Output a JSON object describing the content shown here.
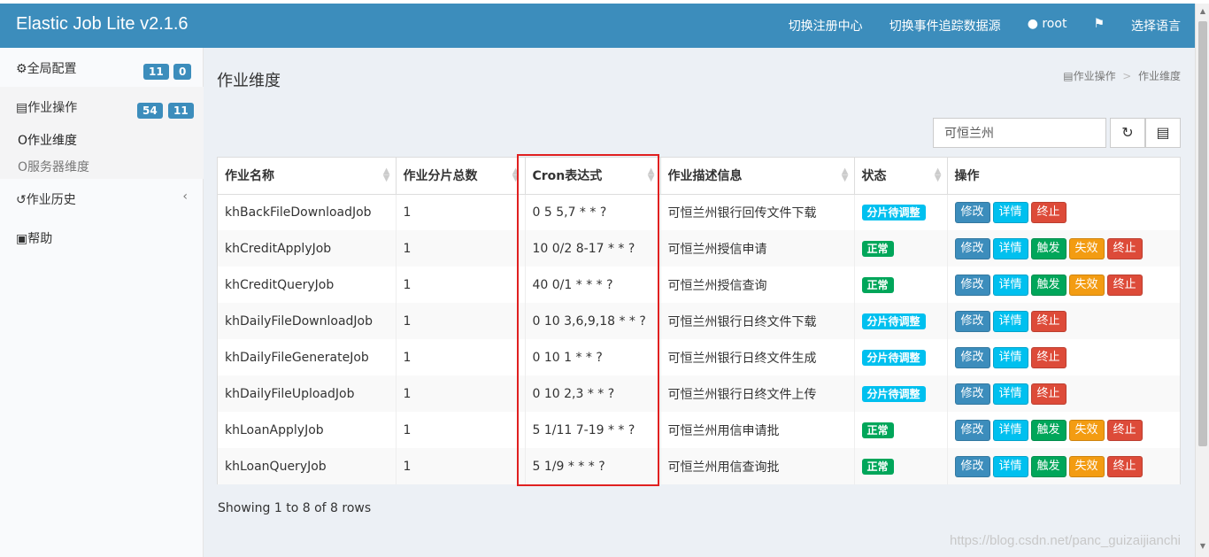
{
  "header": {
    "brand": "Elastic Job Lite v2.1.6",
    "nav": [
      {
        "label": "切换注册中心"
      },
      {
        "label": "切换事件追踪数据源"
      },
      {
        "label": "root",
        "icon": "user-icon"
      },
      {
        "label": "",
        "icon": "flag-icon"
      },
      {
        "label": "选择语言"
      }
    ]
  },
  "sidebar": {
    "global_config": {
      "label": "全局配置",
      "badge1": "11",
      "badge2": "0"
    },
    "job_ops": {
      "label": "作业操作",
      "badge1": "54",
      "badge2": "11"
    },
    "job_dimension": "作业维度",
    "server_dimension": "服务器维度",
    "job_history": "作业历史",
    "help": "帮助"
  },
  "main": {
    "title": "作业维度",
    "breadcrumb": [
      "作业操作",
      "作业维度"
    ],
    "search_value": "可恒兰州",
    "columns": [
      "作业名称",
      "作业分片总数",
      "Cron表达式",
      "作业描述信息",
      "状态",
      "操作"
    ],
    "rows": [
      {
        "name": "khBackFileDownloadJob",
        "shards": "1",
        "cron": "0 5 5,7 * * ?",
        "desc": "可恒兰州银行回传文件下载",
        "status": "分片待调整",
        "status_color": "#00c0ef",
        "actions": [
          "修改",
          "详情",
          "终止"
        ]
      },
      {
        "name": "khCreditApplyJob",
        "shards": "1",
        "cron": "10 0/2 8-17 * * ?",
        "desc": "可恒兰州授信申请",
        "status": "正常",
        "status_color": "#00a65a",
        "actions": [
          "修改",
          "详情",
          "触发",
          "失效",
          "终止"
        ]
      },
      {
        "name": "khCreditQueryJob",
        "shards": "1",
        "cron": "40 0/1 * * * ?",
        "desc": "可恒兰州授信查询",
        "status": "正常",
        "status_color": "#00a65a",
        "actions": [
          "修改",
          "详情",
          "触发",
          "失效",
          "终止"
        ]
      },
      {
        "name": "khDailyFileDownloadJob",
        "shards": "1",
        "cron": "0 10 3,6,9,18 * * ?",
        "desc": "可恒兰州银行日终文件下载",
        "status": "分片待调整",
        "status_color": "#00c0ef",
        "actions": [
          "修改",
          "详情",
          "终止"
        ]
      },
      {
        "name": "khDailyFileGenerateJob",
        "shards": "1",
        "cron": "0 10 1 * * ?",
        "desc": "可恒兰州银行日终文件生成",
        "status": "分片待调整",
        "status_color": "#00c0ef",
        "actions": [
          "修改",
          "详情",
          "终止"
        ]
      },
      {
        "name": "khDailyFileUploadJob",
        "shards": "1",
        "cron": "0 10 2,3 * * ?",
        "desc": "可恒兰州银行日终文件上传",
        "status": "分片待调整",
        "status_color": "#00c0ef",
        "actions": [
          "修改",
          "详情",
          "终止"
        ]
      },
      {
        "name": "khLoanApplyJob",
        "shards": "1",
        "cron": "5 1/11 7-19 * * ?",
        "desc": "可恒兰州用信申请批",
        "status": "正常",
        "status_color": "#00a65a",
        "actions": [
          "修改",
          "详情",
          "触发",
          "失效",
          "终止"
        ]
      },
      {
        "name": "khLoanQueryJob",
        "shards": "1",
        "cron": "5 1/9 * * * ?",
        "desc": "可恒兰州用信查询批",
        "status": "正常",
        "status_color": "#00a65a",
        "actions": [
          "修改",
          "详情",
          "触发",
          "失效",
          "终止"
        ]
      }
    ],
    "footer": "Showing 1 to 8 of 8 rows",
    "watermark": "https://blog.csdn.net/panc_guizaijianchi"
  }
}
